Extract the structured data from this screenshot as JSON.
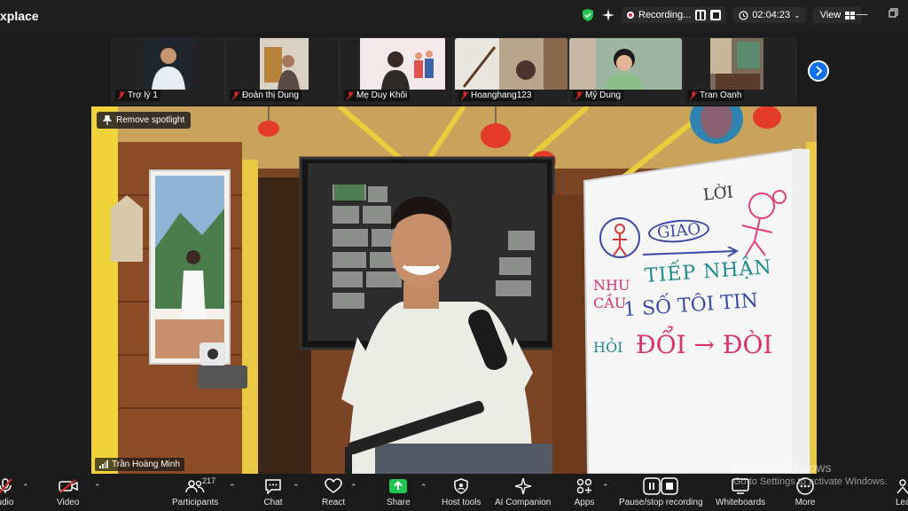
{
  "app": {
    "title": "xplace"
  },
  "status": {
    "recording_label": "Recording...",
    "timer": "02:04:23",
    "view_label": "View"
  },
  "participants_strip": [
    {
      "name": "Trợ lý 1",
      "muted": true
    },
    {
      "name": "Đoàn thị  Dung",
      "muted": true
    },
    {
      "name": "Mẹ Duy Khôi",
      "muted": true
    },
    {
      "name": "Hoanghang123",
      "muted": true
    },
    {
      "name": "Mỹ Dung",
      "muted": true
    },
    {
      "name": "Tran Oanh",
      "muted": true
    }
  ],
  "spotlight": {
    "remove_label": "Remove spotlight",
    "speaker_name": "Trần Hoàng Minh",
    "whiteboard_text": {
      "top": "LỜI",
      "giao": "GIAO",
      "tiep_nhan": "TIẾP NHẬN",
      "nhu_cau": "NHU CẦU",
      "thong_tin": "1 SỐ TÔI TIN",
      "doi_doi": "ĐỔI → ĐÒI",
      "hoi": "HỎI"
    }
  },
  "toolbar": {
    "audio": "udio",
    "video": "Video",
    "participants": "Participants",
    "participants_count": "217",
    "chat": "Chat",
    "react": "React",
    "share": "Share",
    "host_tools": "Host tools",
    "ai_companion": "AI Companion",
    "apps": "Apps",
    "pause_stop": "Pause/stop recording",
    "whiteboards": "Whiteboards",
    "more": "More",
    "leave": "Lea"
  },
  "watermark": {
    "line1": "Activate Windows",
    "line2": "Go to Settings to activate Windows."
  },
  "colors": {
    "accent": "#0e71eb",
    "share": "#23c552",
    "record": "#e02828"
  }
}
